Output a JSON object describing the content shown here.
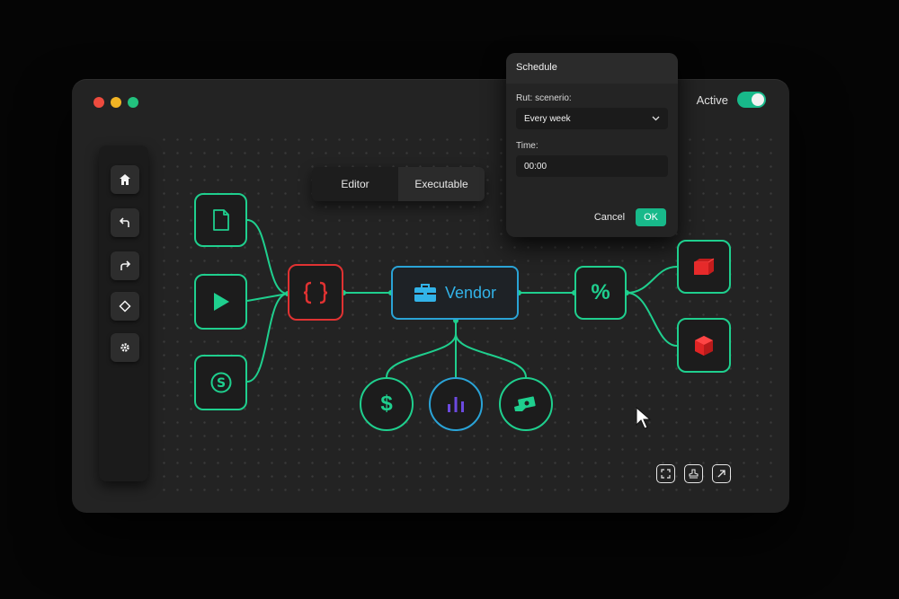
{
  "window": {
    "active_label": "Active",
    "active_on": true
  },
  "sidebar": {
    "items": [
      {
        "name": "home-icon"
      },
      {
        "name": "undo-icon"
      },
      {
        "name": "redo-icon"
      },
      {
        "name": "diamond-icon"
      },
      {
        "name": "gear-icon"
      }
    ]
  },
  "tabs": {
    "editor": "Editor",
    "executable": "Executable",
    "selected": "Executable"
  },
  "schedule": {
    "title": "Schedule",
    "run_label": "Rut: scenerio:",
    "run_value": "Every week",
    "time_label": "Time:",
    "time_value": "00:00",
    "cancel": "Cancel",
    "ok": "OK"
  },
  "flow": {
    "vendor_label": "Vendor",
    "input_nodes": [
      "document-icon",
      "play-icon",
      "coin-icon"
    ],
    "code_node": "code-braces-icon",
    "percent_label": "%",
    "sub_nodes": [
      "dollar-icon",
      "bar-chart-icon",
      "money-hand-icon"
    ],
    "output_nodes": [
      "red-box-icon",
      "red-cube-icon"
    ]
  },
  "toolbar": {
    "tools": [
      "screenshot-icon",
      "stamp-icon",
      "export-arrow-icon"
    ]
  },
  "colors": {
    "accent": "#1fcf8e",
    "error": "#e03232",
    "vendor": "#2aa3d6",
    "chart": "#6c4ae0",
    "toggle": "#18b98a"
  }
}
